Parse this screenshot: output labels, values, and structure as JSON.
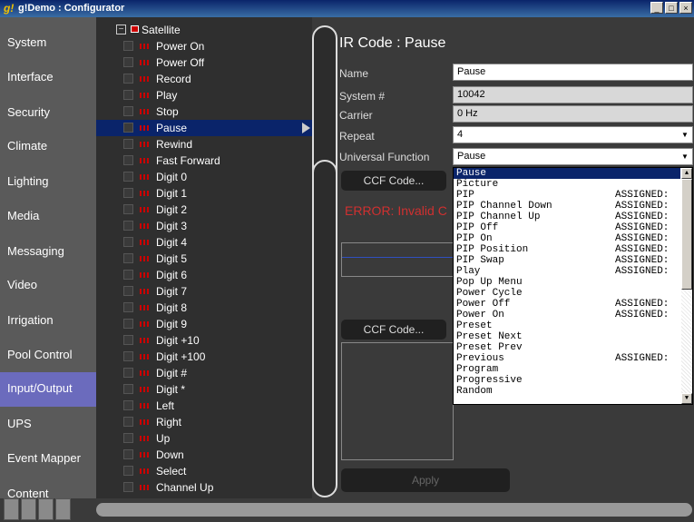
{
  "window": {
    "title": "g!Demo : Configurator",
    "app_icon": "g!",
    "buttons": [
      "minimize",
      "maximize",
      "close"
    ]
  },
  "sidebar": {
    "items": [
      {
        "label": "System"
      },
      {
        "label": "Interface"
      },
      {
        "label": "Security"
      },
      {
        "label": "Climate"
      },
      {
        "label": "Lighting"
      },
      {
        "label": "Media"
      },
      {
        "label": "Messaging"
      },
      {
        "label": "Video"
      },
      {
        "label": "Irrigation"
      },
      {
        "label": "Pool Control"
      },
      {
        "label": "Input/Output"
      },
      {
        "label": "UPS"
      },
      {
        "label": "Event Mapper"
      },
      {
        "label": "Content"
      }
    ],
    "active": "Input/Output",
    "active_color": "#6b6bbd"
  },
  "tree": {
    "root": {
      "label": "Satellite",
      "expander": "−"
    },
    "items": [
      {
        "label": "Power On"
      },
      {
        "label": "Power Off"
      },
      {
        "label": "Record"
      },
      {
        "label": "Play"
      },
      {
        "label": "Stop"
      },
      {
        "label": "Pause"
      },
      {
        "label": "Rewind"
      },
      {
        "label": "Fast Forward"
      },
      {
        "label": "Digit 0"
      },
      {
        "label": "Digit 1"
      },
      {
        "label": "Digit 2"
      },
      {
        "label": "Digit 3"
      },
      {
        "label": "Digit 4"
      },
      {
        "label": "Digit 5"
      },
      {
        "label": "Digit 6"
      },
      {
        "label": "Digit 7"
      },
      {
        "label": "Digit 8"
      },
      {
        "label": "Digit 9"
      },
      {
        "label": "Digit +10"
      },
      {
        "label": "Digit +100"
      },
      {
        "label": "Digit #"
      },
      {
        "label": "Digit *"
      },
      {
        "label": "Left"
      },
      {
        "label": "Right"
      },
      {
        "label": "Up"
      },
      {
        "label": "Down"
      },
      {
        "label": "Select"
      },
      {
        "label": "Channel Up"
      }
    ],
    "selected": "Pause",
    "selected_color": "#0a246a",
    "ir_icon_color": "#cc0000"
  },
  "details": {
    "title": "IR Code : Pause",
    "name_label": "Name",
    "name_value": "Pause",
    "system_label": "System #",
    "system_value": "10042",
    "carrier_label": "Carrier",
    "carrier_value": "0 Hz",
    "repeat_label": "Repeat",
    "repeat_value": "4",
    "uf_label": "Universal Function",
    "uf_value": "Pause",
    "ccf_button_1": "CCF Code...",
    "ccf_button_2": "CCF Code...",
    "error_text": "ERROR: Invalid C",
    "error_color": "#d03030",
    "apply_button": "Apply"
  },
  "function_list": {
    "items": [
      {
        "label": "Pause",
        "status": ""
      },
      {
        "label": "Picture",
        "status": ""
      },
      {
        "label": "PIP",
        "status": "ASSIGNED:"
      },
      {
        "label": "PIP Channel Down",
        "status": "ASSIGNED:"
      },
      {
        "label": "PIP Channel Up",
        "status": "ASSIGNED:"
      },
      {
        "label": "PIP Off",
        "status": "ASSIGNED:"
      },
      {
        "label": "PIP On",
        "status": "ASSIGNED:"
      },
      {
        "label": "PIP Position",
        "status": "ASSIGNED:"
      },
      {
        "label": "PIP Swap",
        "status": "ASSIGNED:"
      },
      {
        "label": "Play",
        "status": "ASSIGNED:"
      },
      {
        "label": "Pop Up Menu",
        "status": ""
      },
      {
        "label": "Power Cycle",
        "status": ""
      },
      {
        "label": "Power Off",
        "status": "ASSIGNED:"
      },
      {
        "label": "Power On",
        "status": "ASSIGNED:"
      },
      {
        "label": "Preset",
        "status": ""
      },
      {
        "label": "Preset Next",
        "status": ""
      },
      {
        "label": "Preset Prev",
        "status": ""
      },
      {
        "label": "Previous",
        "status": "ASSIGNED:"
      },
      {
        "label": "Program",
        "status": ""
      },
      {
        "label": "Progressive",
        "status": ""
      },
      {
        "label": "Random",
        "status": ""
      }
    ],
    "selected": "Pause",
    "scroll_up_icon": "▲",
    "scroll_down_icon": "▼"
  },
  "icons": {
    "dropdown": "▼",
    "tree_arrow": "play-arrow"
  }
}
